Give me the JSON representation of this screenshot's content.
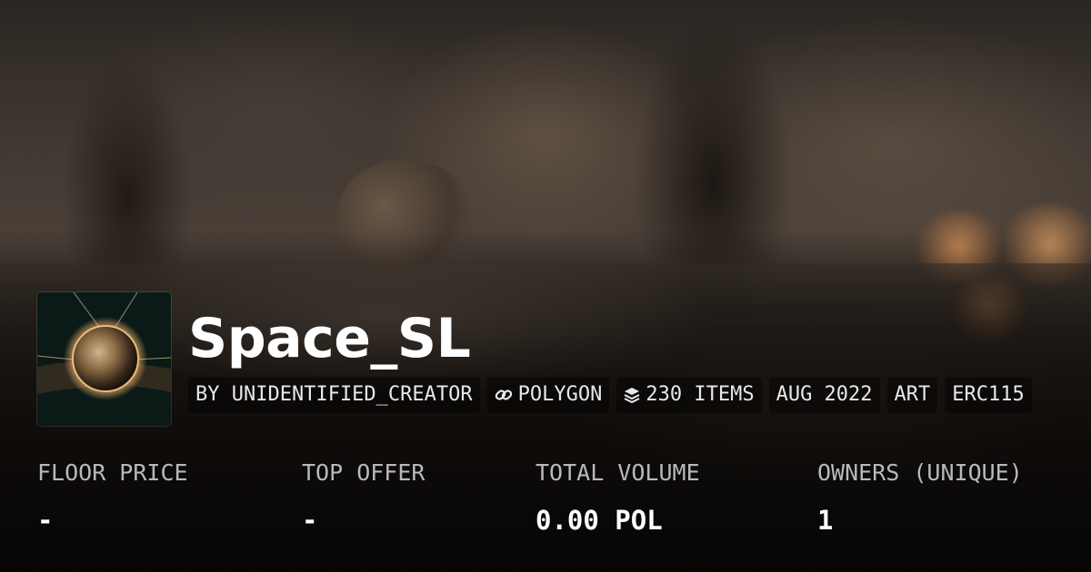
{
  "collection": {
    "name": "Space_SL",
    "thumbnail_alt": "glowing-sphere-artwork"
  },
  "tags": [
    {
      "label": "BY UNIDENTIFIED_CREATOR",
      "icon": ""
    },
    {
      "label": "POLYGON",
      "icon": "chain-link-icon"
    },
    {
      "label": "230 ITEMS",
      "icon": "layers-icon"
    },
    {
      "label": "AUG 2022",
      "icon": ""
    },
    {
      "label": "ART",
      "icon": ""
    },
    {
      "label": "ERC115",
      "icon": ""
    }
  ],
  "stats": [
    {
      "label": "FLOOR PRICE",
      "value": "-"
    },
    {
      "label": "TOP OFFER",
      "value": "-"
    },
    {
      "label": "TOTAL VOLUME",
      "value": "0.00 POL"
    },
    {
      "label": "OWNERS (UNIQUE)",
      "value": "1"
    }
  ],
  "colors": {
    "text_primary": "#ffffff",
    "text_secondary": "#b9b9b9",
    "tag_background": "rgba(0,0,0,0.38)"
  }
}
